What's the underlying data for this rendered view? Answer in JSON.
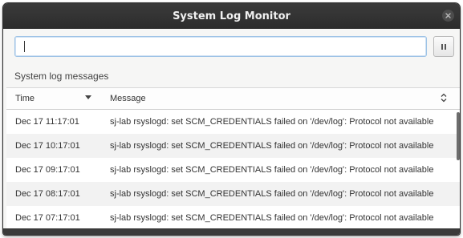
{
  "window": {
    "title": "System Log Monitor"
  },
  "search": {
    "value": "",
    "placeholder": ""
  },
  "pane_label": "System log messages",
  "table": {
    "columns": {
      "time": "Time",
      "message": "Message"
    },
    "rows": [
      {
        "time": "Dec 17 11:17:01",
        "message": "sj-lab rsyslogd: set SCM_CREDENTIALS failed on '/dev/log': Protocol not available"
      },
      {
        "time": "Dec 17 10:17:01",
        "message": "sj-lab rsyslogd: set SCM_CREDENTIALS failed on '/dev/log': Protocol not available"
      },
      {
        "time": "Dec 17 09:17:01",
        "message": "sj-lab rsyslogd: set SCM_CREDENTIALS failed on '/dev/log': Protocol not available"
      },
      {
        "time": "Dec 17 08:17:01",
        "message": "sj-lab rsyslogd: set SCM_CREDENTIALS failed on '/dev/log': Protocol not available"
      },
      {
        "time": "Dec 17 07:17:01",
        "message": "sj-lab rsyslogd: set SCM_CREDENTIALS failed on '/dev/log': Protocol not available"
      }
    ]
  },
  "icons": {
    "close": "close-icon",
    "pause": "pause-icon",
    "sort_time": "sort-down-icon",
    "sort_message": "sort-updown-icon"
  },
  "colors": {
    "titlebar": "#2f2f2f",
    "input_focus_border": "#9ec3e6",
    "row_alt": "#f2f2f2"
  }
}
